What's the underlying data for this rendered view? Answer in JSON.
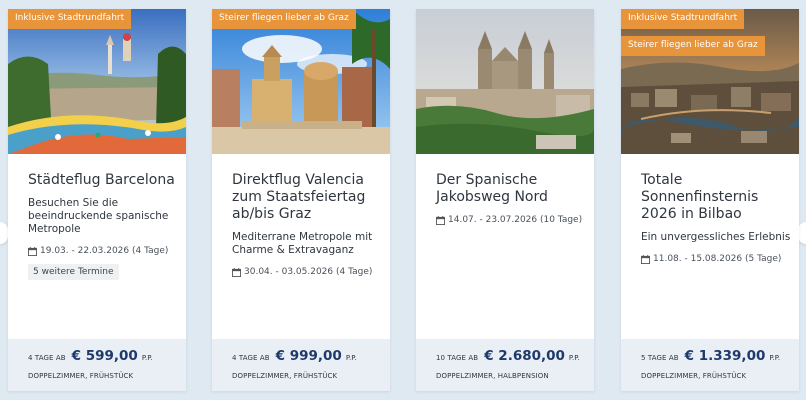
{
  "cards": [
    {
      "badges": [
        "Inklusive Stadtrundfahrt"
      ],
      "image_icon": "barcelona-park-guell-photo",
      "title": "Städteflug Barcelona",
      "subtitle": "Besuchen Sie die beeindruckende spanische Metropole",
      "dates": "19.03. - 22.03.2026 (4 Tage)",
      "more_dates": "5 weitere Termine",
      "price_prefix": "4 TAGE AB",
      "price": "€ 599,00",
      "price_suffix": "P.P.",
      "board": "DOPPELZIMMER, FRÜHSTÜCK"
    },
    {
      "badges": [
        "Steirer fliegen lieber ab Graz"
      ],
      "image_icon": "valencia-cathedral-photo",
      "title": "Direktflug Valencia zum Staatsfeiertag ab/bis Graz",
      "subtitle": "Mediterrane Metropole mit Charme & Extravaganz",
      "dates": "30.04. - 03.05.2026 (4 Tage)",
      "price_prefix": "4 TAGE AB",
      "price": "€ 999,00",
      "price_suffix": "P.P.",
      "board": "DOPPELZIMMER, FRÜHSTÜCK"
    },
    {
      "badges": [],
      "image_icon": "santiago-cathedral-photo",
      "title": "Der Spanische Jakobsweg Nord",
      "dates": "14.07. - 23.07.2026 (10 Tage)",
      "price_prefix": "10 TAGE AB",
      "price": "€ 2.680,00",
      "price_suffix": "P.P.",
      "board": "DOPPELZIMMER, HALBPENSION"
    },
    {
      "badges": [
        "Inklusive Stadtrundfahrt",
        "Steirer fliegen lieber ab Graz"
      ],
      "image_icon": "bilbao-city-photo",
      "title": "Totale Sonnenfinsternis 2026 in Bilbao",
      "subtitle": "Ein unvergessliches Erlebnis",
      "dates": "11.08. - 15.08.2026 (5 Tage)",
      "price_prefix": "5 TAGE AB",
      "price": "€ 1.339,00",
      "price_suffix": "P.P.",
      "board": "DOPPELZIMMER, FRÜHSTÜCK"
    }
  ],
  "colors": {
    "page_background": "#dfe9f2",
    "badge": "#e8943a",
    "price": "#1d3a6a",
    "footer_background": "#e9eff5"
  }
}
